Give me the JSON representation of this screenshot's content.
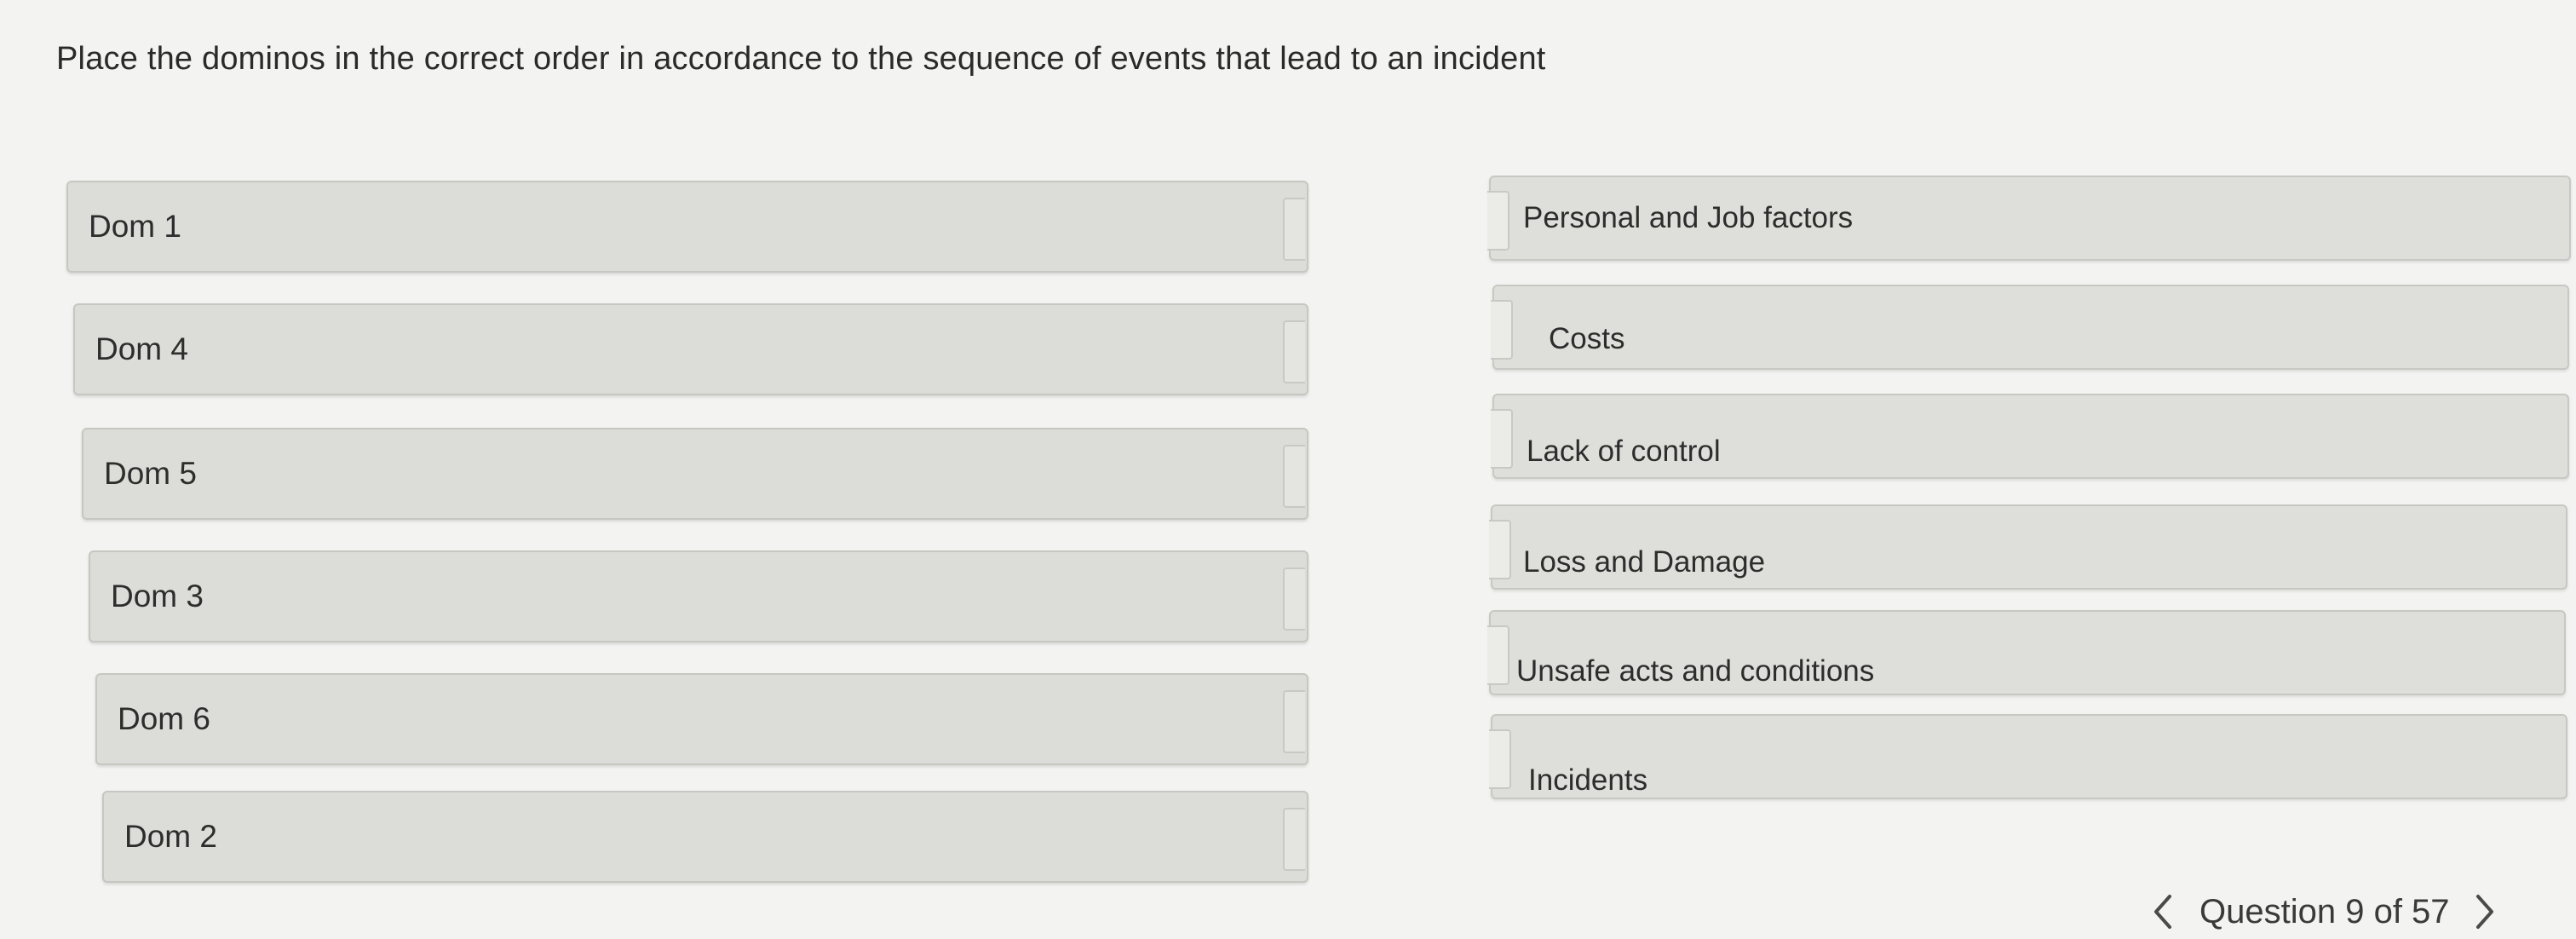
{
  "question": {
    "prompt": "Place the dominos in the correct order in accordance to the sequence of events that lead to an incident"
  },
  "dominos": [
    {
      "label": "Dom 1"
    },
    {
      "label": "Dom 4"
    },
    {
      "label": "Dom 5"
    },
    {
      "label": "Dom 3"
    },
    {
      "label": "Dom 6"
    },
    {
      "label": "Dom 2"
    }
  ],
  "targets": [
    {
      "label": "Personal and Job factors"
    },
    {
      "label": "Costs"
    },
    {
      "label": "Lack of control"
    },
    {
      "label": "Loss and Damage"
    },
    {
      "label": "Unsafe acts and conditions"
    },
    {
      "label": "Incidents"
    }
  ],
  "navigation": {
    "status": "Question 9 of 57",
    "prev_icon": "chevron-left-icon",
    "next_icon": "chevron-right-icon"
  }
}
